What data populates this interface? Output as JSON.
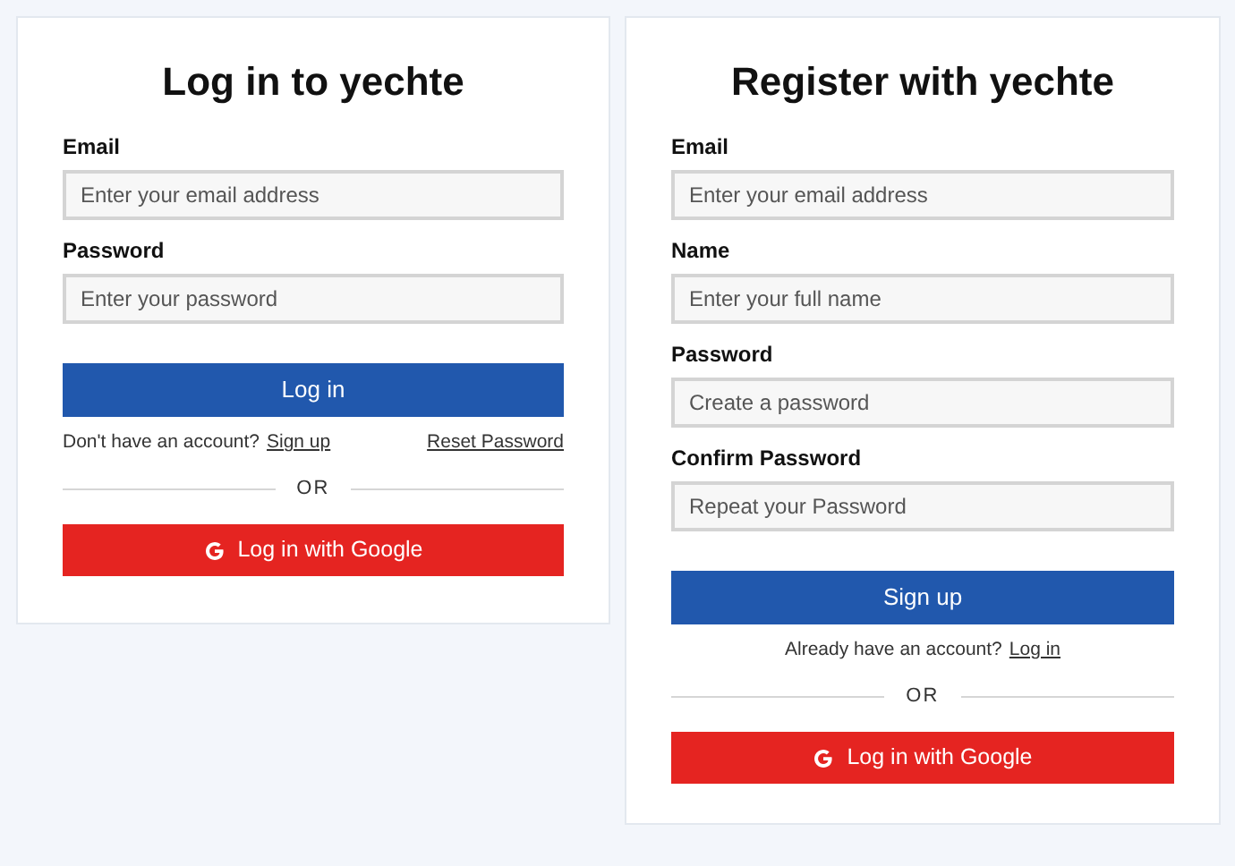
{
  "login": {
    "title": "Log in to yechte",
    "fields": [
      {
        "label": "Email",
        "placeholder": "Enter your email address"
      },
      {
        "label": "Password",
        "placeholder": "Enter your password"
      }
    ],
    "submit": "Log in",
    "prompt": "Don't have an account?",
    "prompt_link": "Sign up",
    "reset_link": "Reset Password",
    "divider": "OR",
    "google_button": "Log in with Google"
  },
  "register": {
    "title": "Register with yechte",
    "fields": [
      {
        "label": "Email",
        "placeholder": "Enter your email address"
      },
      {
        "label": "Name",
        "placeholder": "Enter your full name"
      },
      {
        "label": "Password",
        "placeholder": "Create a password"
      },
      {
        "label": "Confirm Password",
        "placeholder": "Repeat your Password"
      }
    ],
    "submit": "Sign up",
    "prompt": "Already have an account?",
    "prompt_link": "Log in",
    "divider": "OR",
    "google_button": "Log in with Google"
  }
}
